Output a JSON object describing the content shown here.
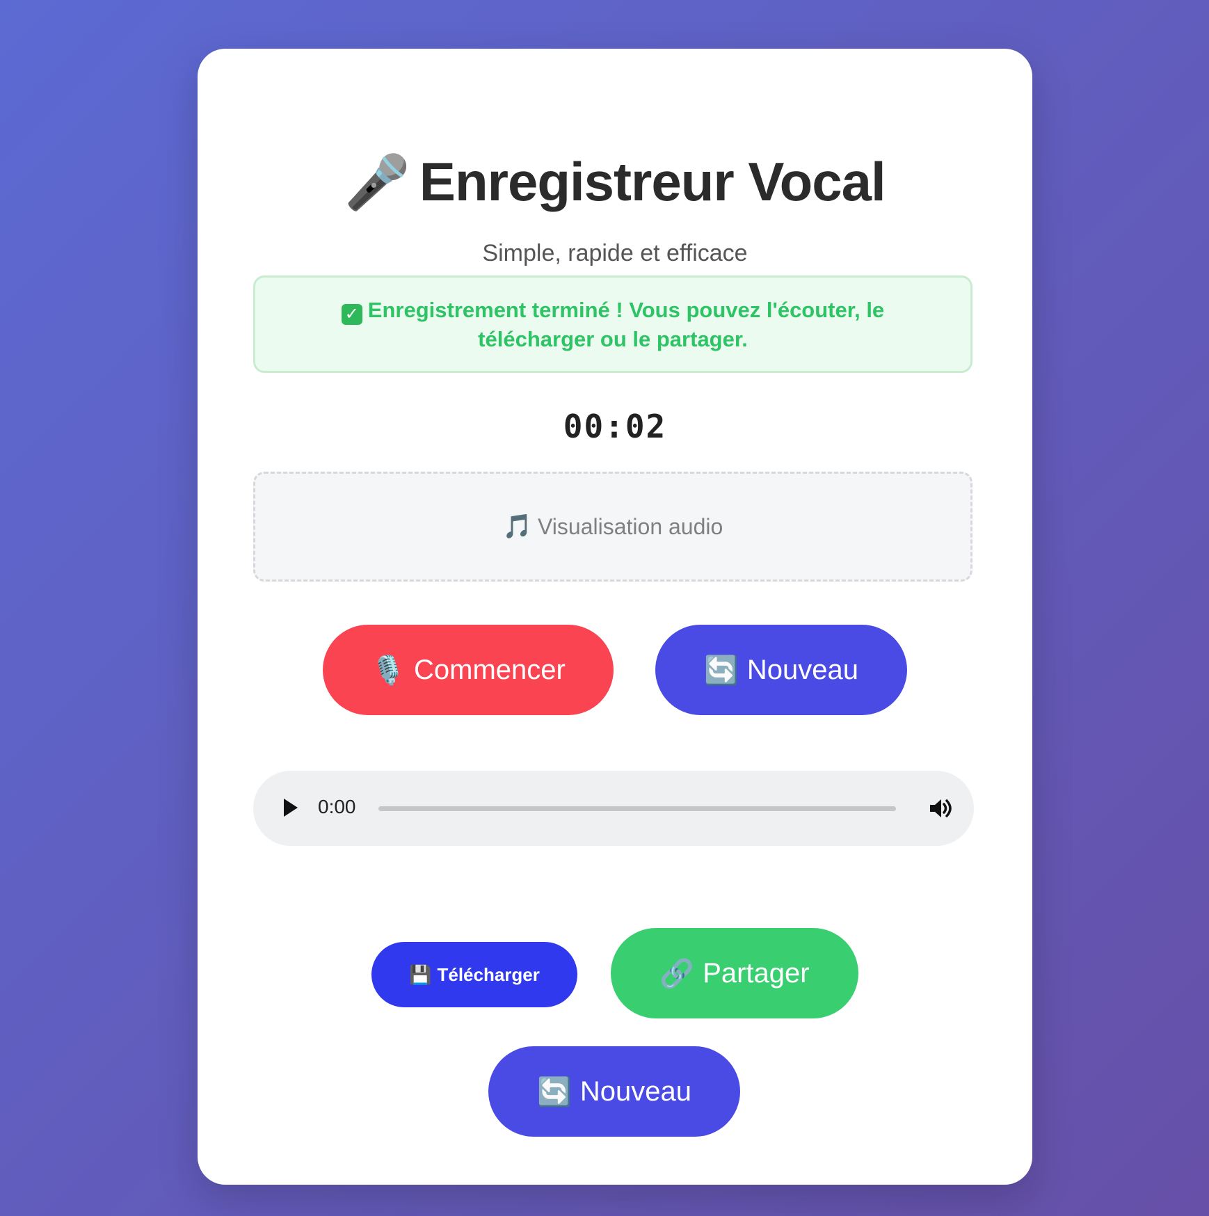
{
  "header": {
    "title_icon": "🎤",
    "title": "Enregistreur Vocal",
    "subtitle": "Simple, rapide et efficace"
  },
  "status": {
    "icon": "✓",
    "message": "Enregistrement terminé ! Vous pouvez l'écouter, le télécharger ou le partager."
  },
  "timer": "00:02",
  "visualization": {
    "icon": "🎵",
    "label": "Visualisation audio"
  },
  "controls": {
    "start": {
      "icon": "🎙️",
      "label": "Commencer"
    },
    "new": {
      "icon": "🔄",
      "label": "Nouveau"
    }
  },
  "audio_player": {
    "current_time": "0:00",
    "progress": 0
  },
  "actions": {
    "download": {
      "icon": "💾",
      "label": "Télécharger"
    },
    "share": {
      "icon": "🔗",
      "label": "Partager"
    },
    "new": {
      "icon": "🔄",
      "label": "Nouveau"
    }
  },
  "colors": {
    "background_start": "#5c6ad3",
    "background_end": "#6650a8",
    "start_button": "#fa4452",
    "new_button": "#4a4ae4",
    "download_button": "#3139ee",
    "share_button": "#39cf71",
    "success_text": "#2ec365"
  }
}
